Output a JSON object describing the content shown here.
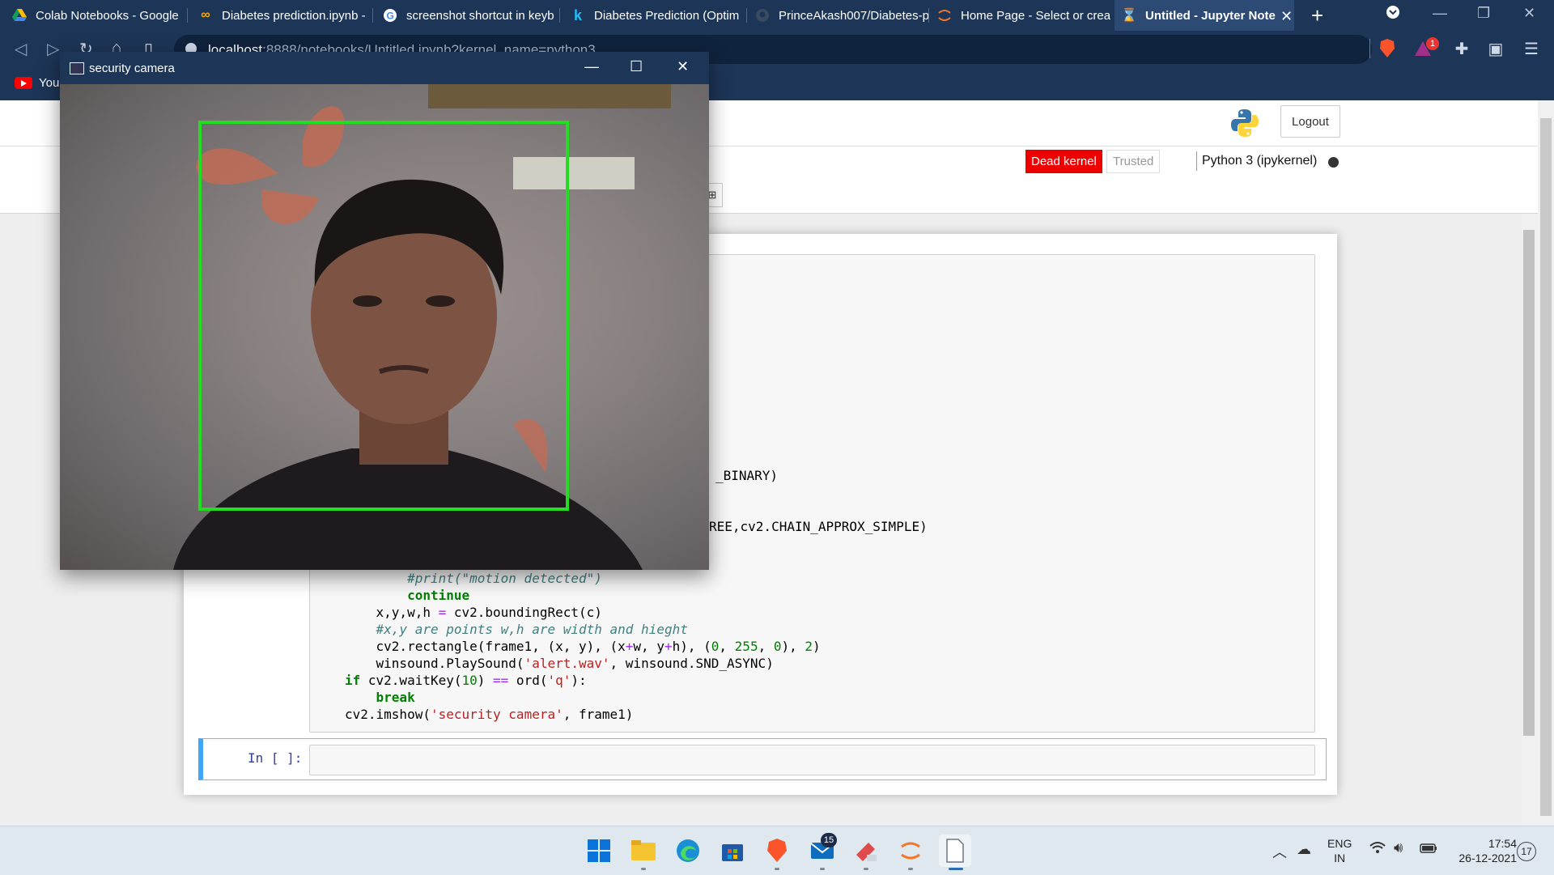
{
  "browser": {
    "tabs": [
      {
        "title": "Colab Notebooks - Google",
        "icon": "google-drive-icon"
      },
      {
        "title": "Diabetes prediction.ipynb -",
        "icon": "colab-icon"
      },
      {
        "title": "screenshot shortcut in keyb",
        "icon": "google-icon"
      },
      {
        "title": "Diabetes Prediction (Optim",
        "icon": "kaggle-icon"
      },
      {
        "title": "PrinceAkash007/Diabetes-p",
        "icon": "github-icon"
      },
      {
        "title": "Home Page - Select or crea",
        "icon": "jupyter-icon"
      },
      {
        "title": "Untitled - Jupyter Note",
        "icon": "hourglass-icon",
        "active": true
      }
    ],
    "url_host": "localhost",
    "url_rest": ":8888/notebooks/Untitled.ipynb?kernel_name=python3",
    "bookmark_youtube": "You",
    "brave_badge": "1"
  },
  "jupyter": {
    "logout_label": "Logout",
    "dead_kernel_label": "Dead kernel",
    "trusted_label": "Trusted",
    "kernel_name": "Python 3 (ipykernel)",
    "toolbar_fragment": "⊞",
    "visible_code_right": {
      "line_binary": "_BINARY)",
      "line_contours": "REE,cv2.CHAIN_APPROX_SIMPLE)"
    },
    "in_prompt": "In [ ]:"
  },
  "camera_window": {
    "title": "security camera",
    "detection_box_color": "#22dd22"
  },
  "taskbar": {
    "mail_badge": "15",
    "lang_top": "ENG",
    "lang_bottom": "IN",
    "time": "17:54",
    "date": "26-12-2021",
    "notification_count": "17"
  }
}
